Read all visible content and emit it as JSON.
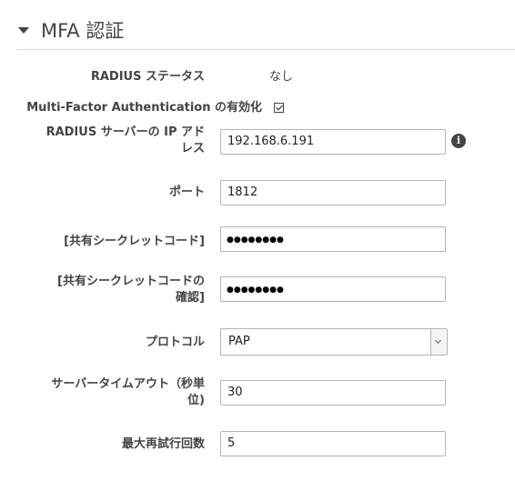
{
  "section": {
    "title": "MFA 認証"
  },
  "fields": {
    "radius_status": {
      "label": "RADIUS ステータス",
      "value": "なし"
    },
    "mfa_enable": {
      "label": "Multi-Factor Authentication の有効化",
      "checked": true
    },
    "radius_ip": {
      "label_line1": "RADIUS サーバーの IP アド",
      "label_line2": "レス",
      "value": "192.168.6.191"
    },
    "port": {
      "label": "ポート",
      "value": "1812"
    },
    "shared_secret": {
      "label": "[共有シークレットコード]",
      "masked_value": "●●●●●●●●"
    },
    "shared_secret_confirm": {
      "label_line1": "[共有シークレットコードの",
      "label_line2": "確認]",
      "masked_value": "●●●●●●●●"
    },
    "protocol": {
      "label": "プロトコル",
      "selected": "PAP"
    },
    "timeout": {
      "label_line1": "サーバータイムアウト（秒単",
      "label_line2": "位)",
      "value": "30"
    },
    "max_retries": {
      "label": "最大再試行回数",
      "value": "5"
    }
  },
  "icons": {
    "section_toggle": "caret-down-icon",
    "info": "info-icon",
    "checkbox_state": "checkmark"
  },
  "colors": {
    "text": "#444444",
    "input_border": "#aab7b8",
    "divider": "#dddddd"
  }
}
